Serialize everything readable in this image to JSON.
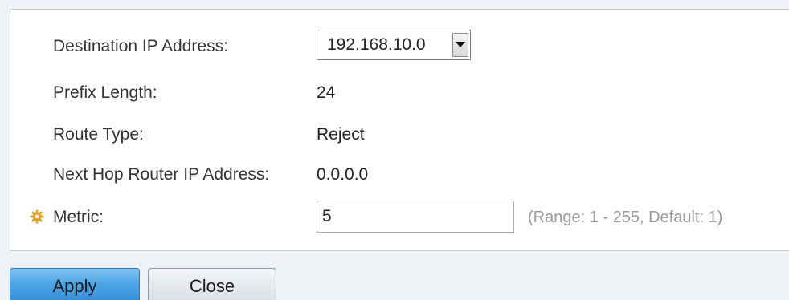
{
  "form": {
    "destination_ip": {
      "label": "Destination IP Address:",
      "selected": "192.168.10.0"
    },
    "prefix_length": {
      "label": "Prefix Length:",
      "value": "24"
    },
    "route_type": {
      "label": "Route Type:",
      "value": "Reject"
    },
    "next_hop": {
      "label": "Next Hop Router IP Address:",
      "value": "0.0.0.0"
    },
    "metric": {
      "label": "Metric:",
      "value": "5",
      "hint": "(Range: 1 - 255, Default: 1)",
      "required_icon": "gear-icon"
    }
  },
  "buttons": {
    "apply": "Apply",
    "close": "Close"
  },
  "colors": {
    "required_icon": "#e8a020",
    "apply_accent": "#4ea6e6",
    "hint_text": "#9a9a9a"
  }
}
